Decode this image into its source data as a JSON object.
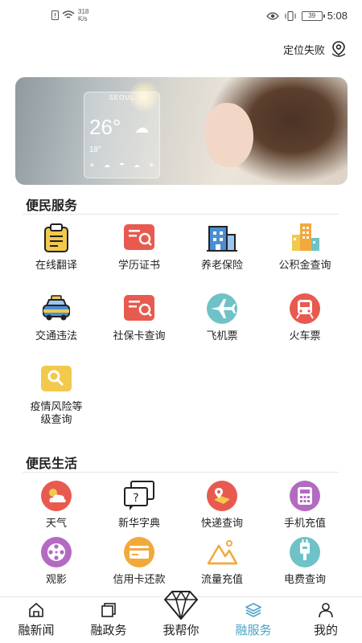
{
  "status_bar": {
    "net_speed_value": "318",
    "net_speed_unit": "K/s",
    "battery": "39",
    "time": "5:08"
  },
  "location": {
    "label": "定位失败",
    "icon": "location-pin-icon"
  },
  "sections": {
    "services": {
      "title": "便民服务",
      "items": [
        {
          "label": "在线翻译",
          "icon": "clipboard-icon"
        },
        {
          "label": "学历证书",
          "icon": "certificate-search-icon"
        },
        {
          "label": "养老保险",
          "icon": "building-icon"
        },
        {
          "label": "公积金查询",
          "icon": "city-buildings-icon"
        },
        {
          "label": "交通违法",
          "icon": "taxi-icon"
        },
        {
          "label": "社保卡查询",
          "icon": "card-search-icon"
        },
        {
          "label": "飞机票",
          "icon": "airplane-icon"
        },
        {
          "label": "火车票",
          "icon": "train-icon"
        },
        {
          "label": "疫情风险等级查询",
          "icon": "search-icon"
        }
      ]
    },
    "life": {
      "title": "便民生活",
      "items": [
        {
          "label": "天气",
          "icon": "weather-icon"
        },
        {
          "label": "新华字典",
          "icon": "dictionary-icon"
        },
        {
          "label": "快递查询",
          "icon": "delivery-map-icon"
        },
        {
          "label": "手机充值",
          "icon": "phone-recharge-icon"
        },
        {
          "label": "观影",
          "icon": "film-reel-icon"
        },
        {
          "label": "信用卡还款",
          "icon": "credit-card-icon"
        },
        {
          "label": "流量充值",
          "icon": "mountain-data-icon"
        },
        {
          "label": "电费查询",
          "icon": "electric-plug-icon"
        }
      ]
    }
  },
  "bottom_nav": {
    "items": [
      {
        "label": "融新闻",
        "icon": "home-icon"
      },
      {
        "label": "融政务",
        "icon": "window-icon"
      },
      {
        "label": "我帮你",
        "icon": "diamond-icon"
      },
      {
        "label": "融服务",
        "icon": "layers-icon"
      },
      {
        "label": "我的",
        "icon": "user-icon"
      }
    ],
    "active_index": 3
  },
  "colors": {
    "accent": "#4aa3c8",
    "red": "#e85a4f",
    "yellow": "#f2c94c",
    "teal": "#6ec2c8",
    "purple": "#b36bc2",
    "orange": "#f2a93b"
  },
  "banner": {
    "weather_city": "SEOUL",
    "weather_temp": "26°",
    "weather_low": "18°"
  }
}
